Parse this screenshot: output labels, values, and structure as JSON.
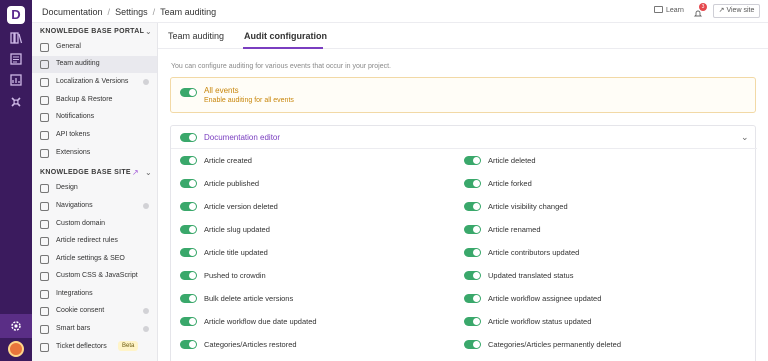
{
  "breadcrumb": [
    "Documentation",
    "Settings",
    "Team auditing"
  ],
  "topbar": {
    "learn": "Learn",
    "notifications_count": "3",
    "view_site": "View site"
  },
  "sidebar": {
    "portal_header": "KNOWLEDGE BASE PORTAL",
    "portal_items": [
      {
        "label": "General",
        "icon": "gear-icon"
      },
      {
        "label": "Team auditing",
        "icon": "audit-icon"
      },
      {
        "label": "Localization & Versions",
        "icon": "translate-icon"
      },
      {
        "label": "Backup & Restore",
        "icon": "backup-icon"
      },
      {
        "label": "Notifications",
        "icon": "bell-icon"
      },
      {
        "label": "API tokens",
        "icon": "key-icon"
      },
      {
        "label": "Extensions",
        "icon": "puzzle-icon"
      }
    ],
    "site_header": "KNOWLEDGE BASE SITE",
    "site_items": [
      {
        "label": "Design",
        "icon": "palette-icon"
      },
      {
        "label": "Navigations",
        "icon": "navigation-icon"
      },
      {
        "label": "Custom domain",
        "icon": "globe-icon"
      },
      {
        "label": "Article redirect rules",
        "icon": "redirect-icon"
      },
      {
        "label": "Article settings & SEO",
        "icon": "settings-icon"
      },
      {
        "label": "Custom CSS & JavaScript",
        "icon": "code-icon"
      },
      {
        "label": "Integrations",
        "icon": "integration-icon"
      },
      {
        "label": "Cookie consent",
        "icon": "cookie-icon"
      },
      {
        "label": "Smart bars",
        "icon": "bars-icon"
      },
      {
        "label": "Ticket deflectors",
        "icon": "ticket-icon",
        "badge": "Beta"
      }
    ]
  },
  "tabs": [
    "Team auditing",
    "Audit configuration"
  ],
  "intro": "You can configure auditing for various events that occur in your project.",
  "all_events": {
    "title": "All events",
    "subtitle": "Enable auditing for all events"
  },
  "doc_editor": {
    "title": "Documentation editor",
    "rows": [
      [
        "Article created",
        "Article deleted"
      ],
      [
        "Article published",
        "Article forked"
      ],
      [
        "Article version deleted",
        "Article visibility changed"
      ],
      [
        "Article slug updated",
        "Article renamed"
      ],
      [
        "Article title updated",
        "Article contributors updated"
      ],
      [
        "Pushed to crowdin",
        "Updated translated status"
      ],
      [
        "Bulk delete article versions",
        "Article workflow assignee updated"
      ],
      [
        "Article workflow due date updated",
        "Article workflow status updated"
      ],
      [
        "Categories/Articles restored",
        "Categories/Articles permanently deleted"
      ]
    ]
  },
  "colors": {
    "accent": "#7a3ec0",
    "toggle_on": "#3aa86b",
    "rail": "#3b1b5e",
    "warning_text": "#c8860b"
  }
}
